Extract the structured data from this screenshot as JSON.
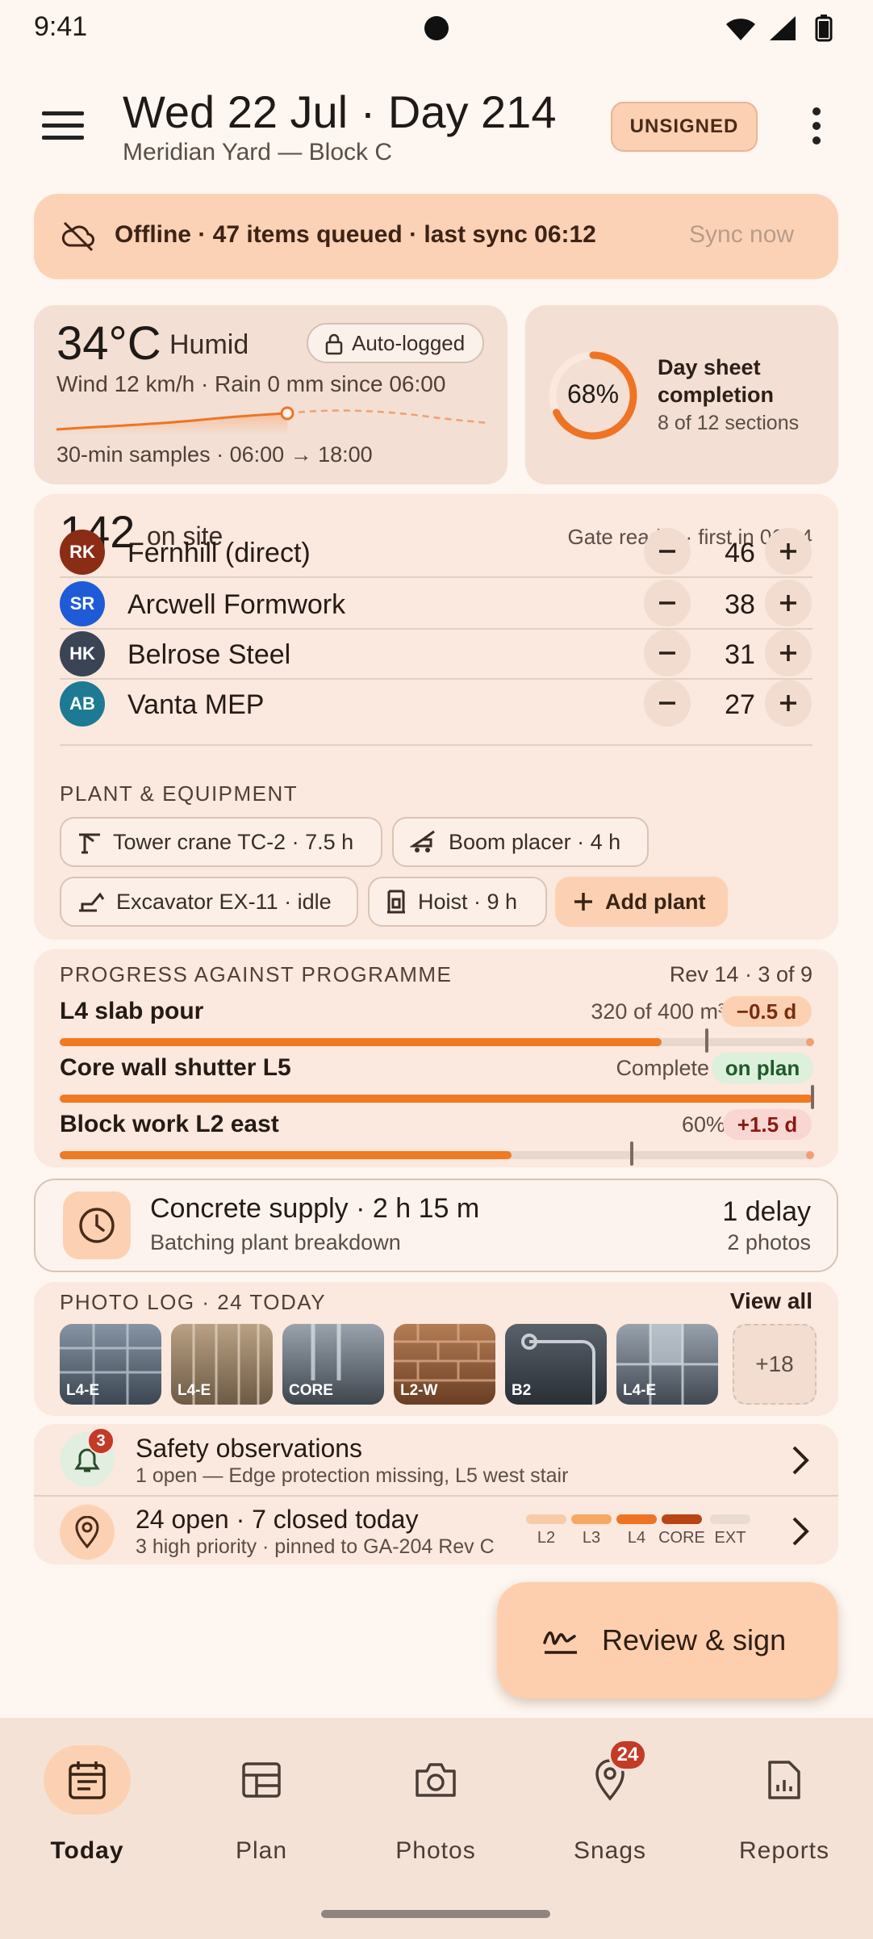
{
  "status_bar": {
    "time": "9:41"
  },
  "header": {
    "title": "Wed 22 Jul · Day 214",
    "subtitle": "Meridian Yard — Block C",
    "badge": "UNSIGNED",
    "icons": [
      "menu-icon",
      "more-vert-icon"
    ]
  },
  "offline_banner": {
    "text": "Offline · 47 items queued · last sync 06:12",
    "action": "Sync now",
    "icon": "cloud-off-icon"
  },
  "weather": {
    "temperature": "34°C",
    "condition": "Humid",
    "auto_logged": "Auto-logged",
    "wind_rain": "Wind 12 km/h · Rain 0 mm since 06:00",
    "samples": "30-min samples · 06:00 → 18:00"
  },
  "completion": {
    "percent_label": "68%",
    "percent": 0.68,
    "title": "Day sheet completion",
    "sections": "8 of 12 sections"
  },
  "on_site": {
    "count": "142",
    "label": "on site",
    "gate": "Gate reader · first in 06:04",
    "crews": [
      {
        "initials": "RK",
        "name": "Fernhill (direct)",
        "count": "46",
        "color": "#8A2D14"
      },
      {
        "initials": "SR",
        "name": "Arcwell Formwork",
        "count": "38",
        "color": "#1F5BD6"
      },
      {
        "initials": "HK",
        "name": "Belrose Steel",
        "count": "31",
        "color": "#3A4455"
      },
      {
        "initials": "AB",
        "name": "Vanta MEP",
        "count": "27",
        "color": "#1C7A94"
      }
    ],
    "plant_heading": "PLANT & EQUIPMENT",
    "plant": [
      {
        "label": "Tower crane TC-2 · 7.5 h",
        "icon": "tower-crane-icon"
      },
      {
        "label": "Boom placer · 4 h",
        "icon": "boom-placer-icon"
      },
      {
        "label": "Excavator EX-11 · idle",
        "icon": "excavator-icon"
      },
      {
        "label": "Hoist · 9 h",
        "icon": "hoist-icon"
      }
    ],
    "add_plant": "Add plant"
  },
  "progress": {
    "heading": "PROGRESS AGAINST PROGRAMME",
    "rev": "Rev 14 · 3 of 9",
    "tasks": [
      {
        "name": "L4 slab pour",
        "meta": "320 of 400 m³",
        "variance": "−0.5 d",
        "fill": 0.8,
        "planned": 0.86
      },
      {
        "name": "Core wall shutter L5",
        "meta": "Complete",
        "variance": "on plan",
        "fill": 1.0,
        "planned": 1.0
      },
      {
        "name": "Block work L2 east",
        "meta": "60%",
        "variance": "+1.5 d",
        "fill": 0.6,
        "planned": 0.76
      }
    ]
  },
  "concrete": {
    "title": "Concrete supply · 2 h 15 m",
    "subtitle": "Batching plant breakdown",
    "delay": "1 delay",
    "photos": "2 photos"
  },
  "photo_log": {
    "heading": "PHOTO LOG · 24 TODAY",
    "view_all": "View all",
    "thumbs": [
      "L4-E",
      "L4-E",
      "CORE",
      "L2-W",
      "B2",
      "L4-E"
    ],
    "more": "+18"
  },
  "safety": {
    "badge": "3",
    "title": "Safety observations",
    "subtitle": "1 open — Edge protection missing, L5 west stair"
  },
  "snags": {
    "title": "24 open · 7 closed today",
    "subtitle": "3 high priority · pinned to GA-204 Rev C",
    "levels": [
      {
        "label": "L2",
        "color": "#F7CBA8"
      },
      {
        "label": "L3",
        "color": "#F5A866"
      },
      {
        "label": "L4",
        "color": "#EE7424"
      },
      {
        "label": "CORE",
        "color": "#B94414"
      },
      {
        "label": "EXT",
        "color": "#EADBD2"
      }
    ]
  },
  "fab": {
    "label": "Review & sign",
    "icon": "signature-icon"
  },
  "bottom_nav": {
    "items": [
      {
        "label": "Today",
        "icon": "calendar-icon"
      },
      {
        "label": "Plan",
        "icon": "grid-icon"
      },
      {
        "label": "Photos",
        "icon": "camera-icon"
      },
      {
        "label": "Snags",
        "icon": "pin-icon",
        "badge": "24"
      },
      {
        "label": "Reports",
        "icon": "report-icon"
      }
    ]
  }
}
